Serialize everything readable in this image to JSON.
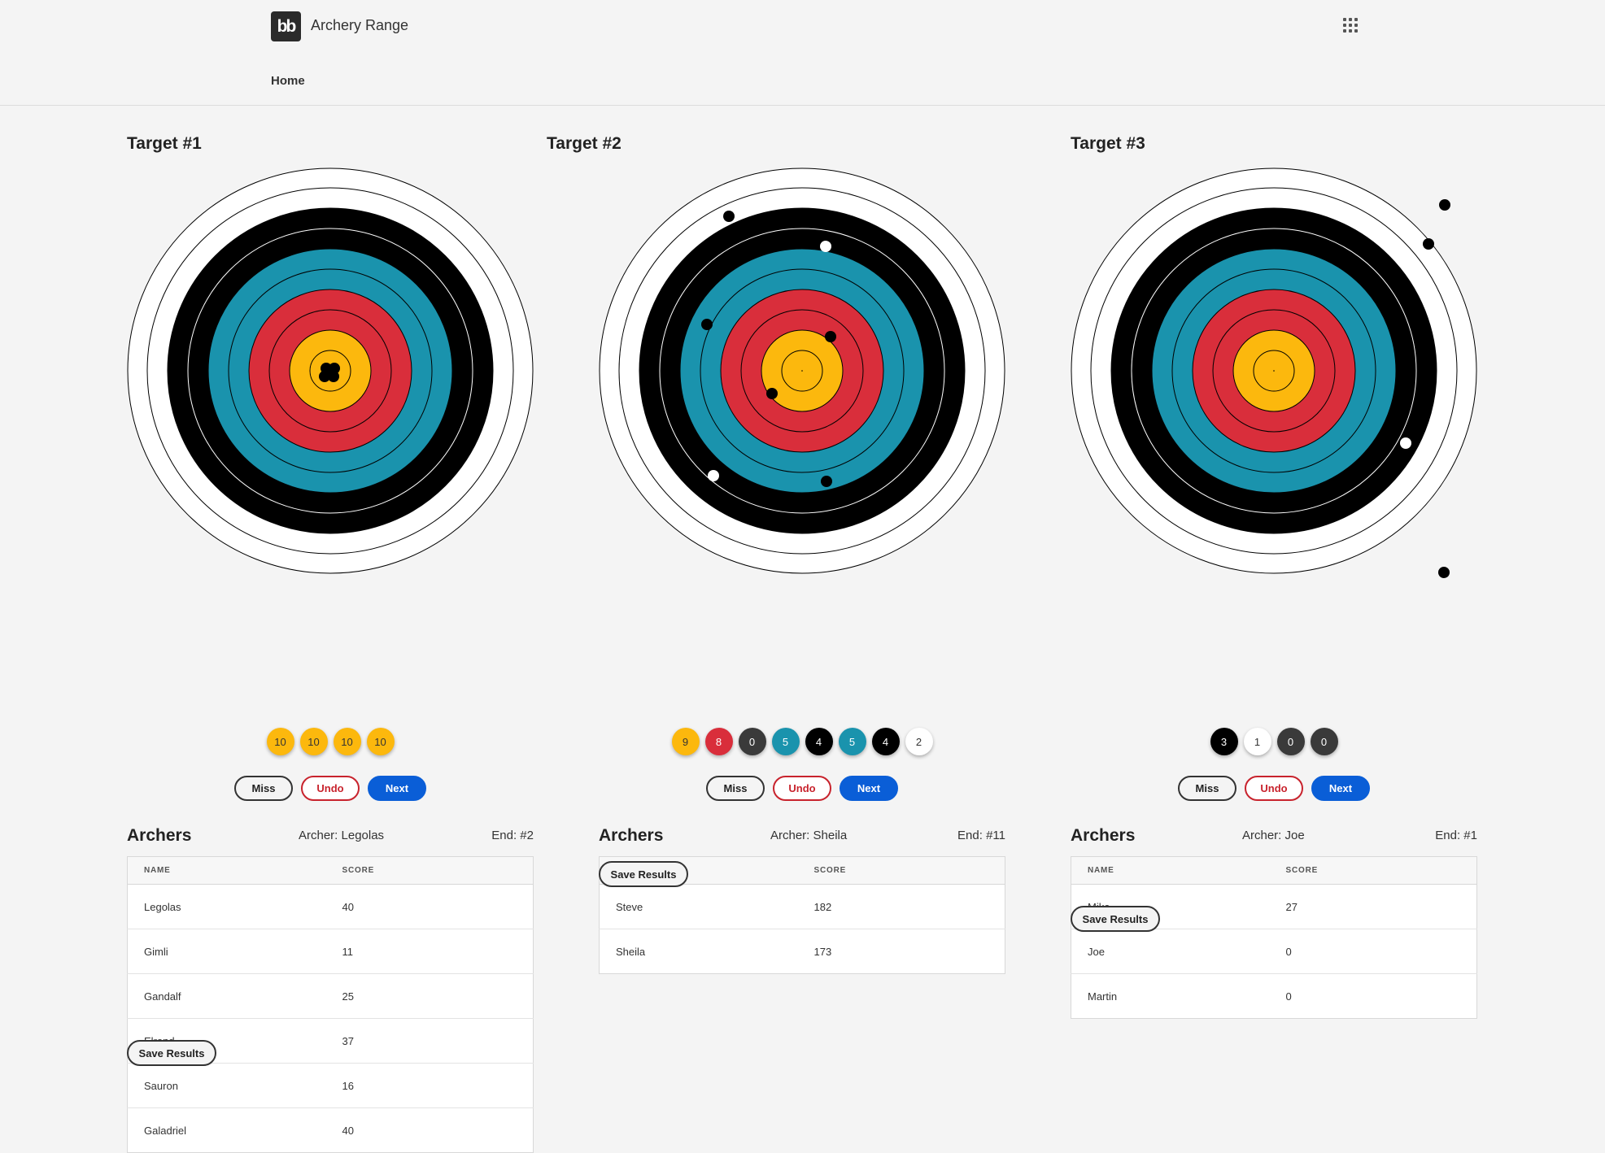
{
  "app": {
    "logo_text": "bb",
    "title": "Archery Range",
    "menu_icon": "grid-icon"
  },
  "nav": {
    "home_label": "Home"
  },
  "colors": {
    "gold": "#fcb80d",
    "red": "#d92e3b",
    "blue": "#1a93ad",
    "black": "#000000",
    "white": "#ffffff",
    "chip_dark": "#3a3a3a",
    "undo": "#c8232d",
    "next": "#0a5ed7"
  },
  "buttons": {
    "miss": "Miss",
    "undo": "Undo",
    "next": "Next",
    "save": "Save Results"
  },
  "archers_heading": "Archers",
  "table_headers": {
    "name": "NAME",
    "score": "SCORE"
  },
  "targets": [
    {
      "title": "Target #1",
      "archer": "Archer: Legolas",
      "end": "End: #2",
      "scores": [
        {
          "value": "10",
          "color": "gold"
        },
        {
          "value": "10",
          "color": "gold"
        },
        {
          "value": "10",
          "color": "gold"
        },
        {
          "value": "10",
          "color": "gold"
        }
      ],
      "archers": [
        {
          "name": "Legolas",
          "score": "40"
        },
        {
          "name": "Gimli",
          "score": "11"
        },
        {
          "name": "Gandalf",
          "score": "25"
        },
        {
          "name": "Elrond",
          "score": "37"
        },
        {
          "name": "Sauron",
          "score": "16"
        },
        {
          "name": "Galadriel",
          "score": "40"
        }
      ]
    },
    {
      "title": "Target #2",
      "archer": "Archer: Sheila",
      "end": "End: #11",
      "scores": [
        {
          "value": "9",
          "color": "gold"
        },
        {
          "value": "8",
          "color": "red"
        },
        {
          "value": "0",
          "color": "chip_dark"
        },
        {
          "value": "5",
          "color": "blue"
        },
        {
          "value": "4",
          "color": "black"
        },
        {
          "value": "5",
          "color": "blue"
        },
        {
          "value": "4",
          "color": "black"
        },
        {
          "value": "2",
          "color": "white"
        }
      ],
      "archers": [
        {
          "name": "Steve",
          "score": "182"
        },
        {
          "name": "Sheila",
          "score": "173"
        }
      ]
    },
    {
      "title": "Target #3",
      "archer": "Archer: Joe",
      "end": "End: #1",
      "scores": [
        {
          "value": "3",
          "color": "black"
        },
        {
          "value": "1",
          "color": "white"
        },
        {
          "value": "0",
          "color": "chip_dark"
        },
        {
          "value": "0",
          "color": "chip_dark"
        }
      ],
      "archers": [
        {
          "name": "Mike",
          "score": "27"
        },
        {
          "name": "Joe",
          "score": "0"
        },
        {
          "name": "Martin",
          "score": "0"
        }
      ]
    }
  ]
}
